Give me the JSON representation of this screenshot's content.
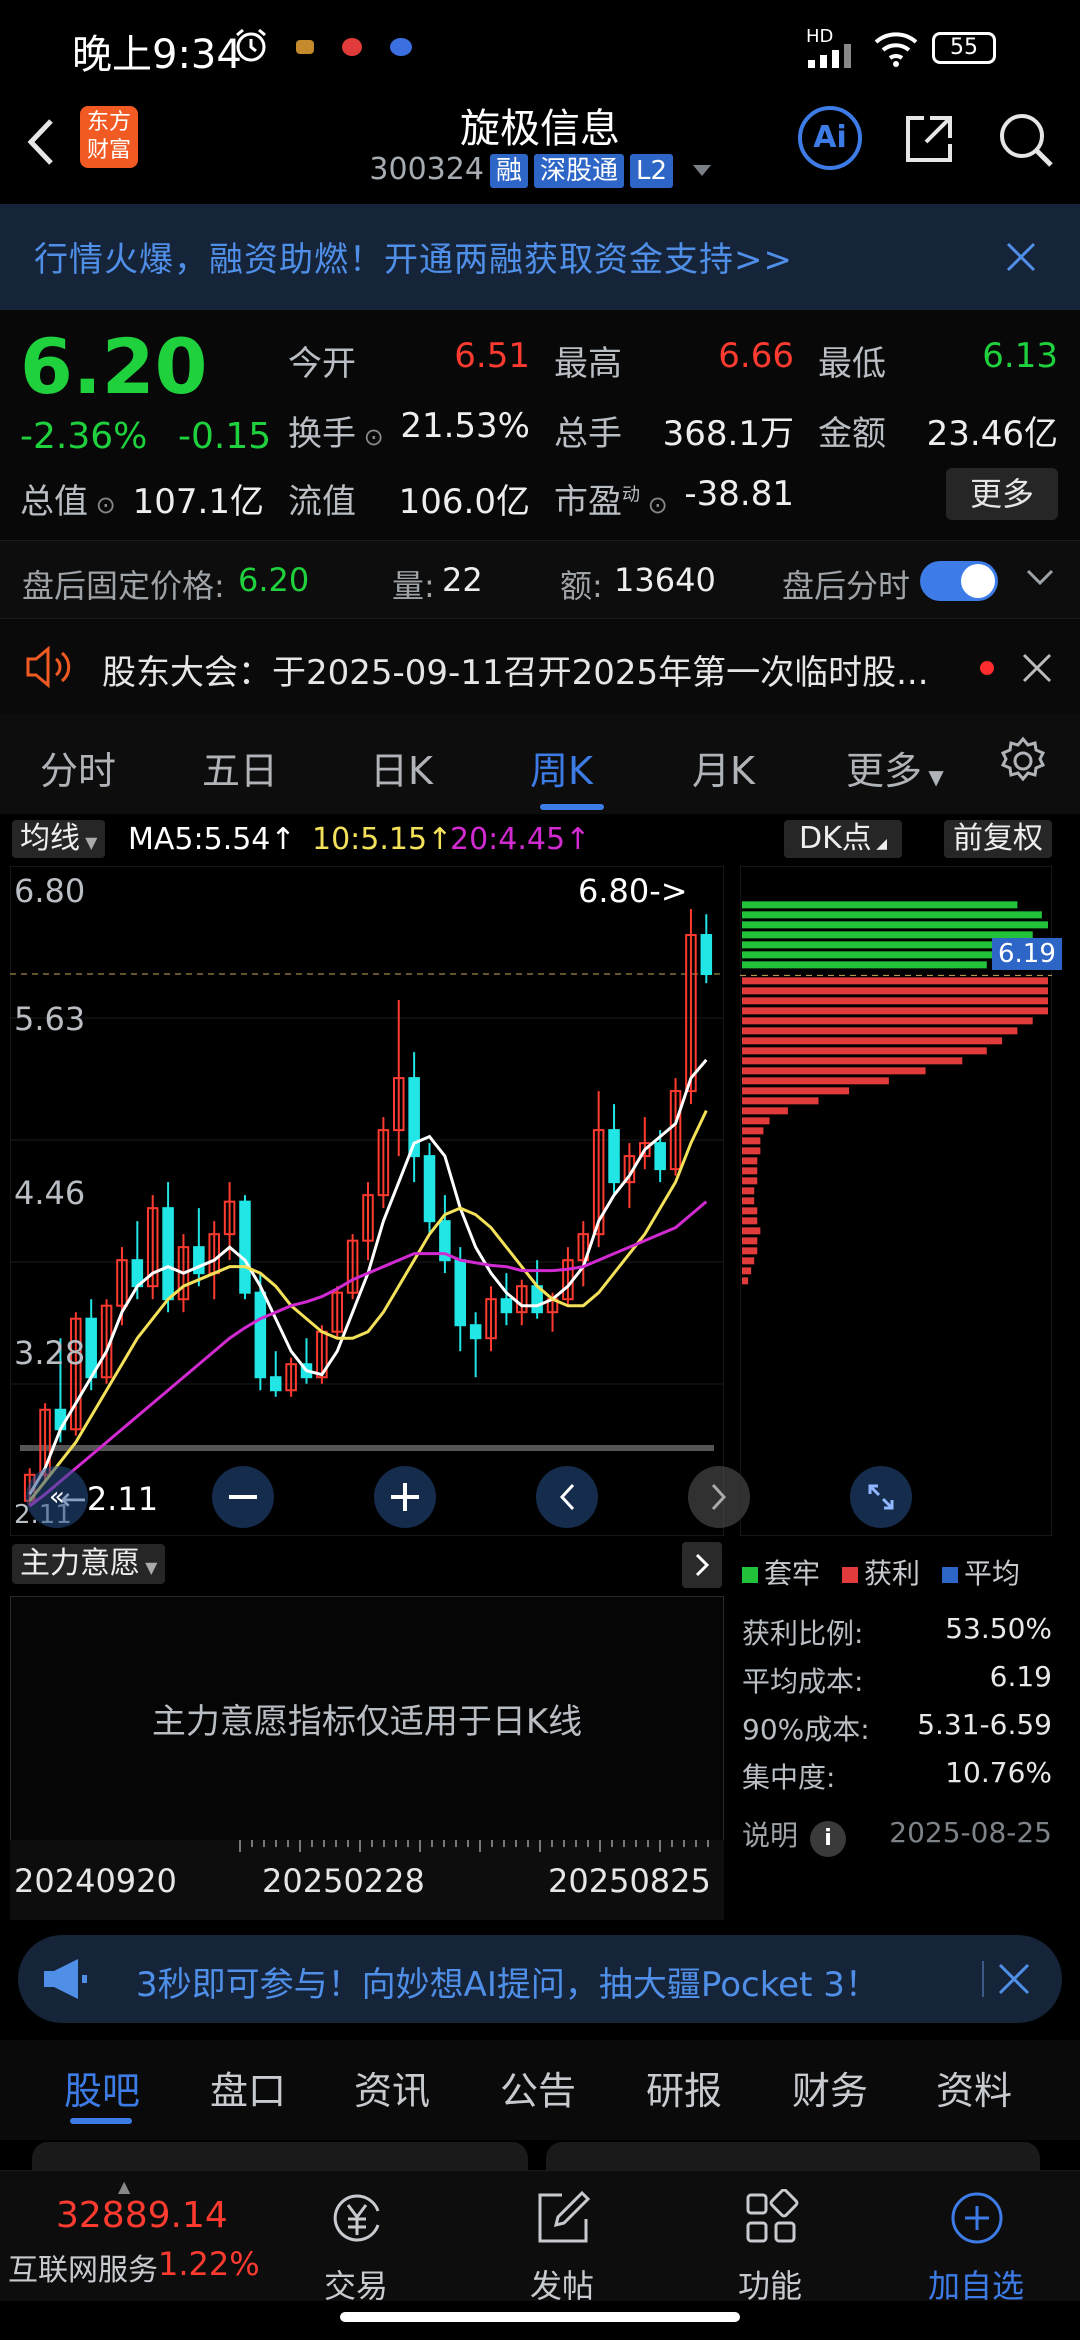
{
  "status_bar": {
    "time": "晚上9:34",
    "network": "HD",
    "battery": "55"
  },
  "header": {
    "logo_line1": "东方",
    "logo_line2": "财富",
    "title": "旋极信息",
    "code": "300324",
    "tags": [
      "融",
      "深股通",
      "L2"
    ],
    "ai_label": "Ai"
  },
  "banner": {
    "text": "行情火爆，融资助燃！开通两融获取资金支持>>"
  },
  "quote": {
    "price": "6.20",
    "change_pct": "-2.36%",
    "change": "-0.15",
    "open_label": "今开",
    "open": "6.51",
    "high_label": "最高",
    "high": "6.66",
    "low_label": "最低",
    "low": "6.13",
    "turnover_label": "换手",
    "turnover": "21.53%",
    "volume_label": "总手",
    "volume": "368.1万",
    "amount_label": "金额",
    "amount": "23.46亿",
    "mktcap_label": "总值",
    "mktcap": "107.1亿",
    "float_label": "流值",
    "float": "106.0亿",
    "pe_label": "市盈",
    "pe_sup": "动",
    "pe": "-38.81",
    "more_label": "更多"
  },
  "after_hours": {
    "price_label": "盘后固定价格:",
    "price": "6.20",
    "vol_label": "量:",
    "vol": "22",
    "amt_label": "额:",
    "amt": "13640",
    "toggle_label": "盘后分时"
  },
  "notice": {
    "text": "股东大会：于2025-09-11召开2025年第一次临时股..."
  },
  "chart_tabs": {
    "items": [
      "分时",
      "五日",
      "日K",
      "周K",
      "月K",
      "更多"
    ],
    "active": 3
  },
  "ma_bar": {
    "selector": "均线",
    "ma5": "MA5:5.54↑",
    "ma10": "10:5.15↑",
    "ma20": "20:4.45↑",
    "dk": "DK点",
    "adjust": "前复权"
  },
  "colors": {
    "up": "#ff3b30",
    "down": "#22e6e6",
    "ma5": "#ffffff",
    "ma10": "#f4e15a",
    "ma20": "#d12ad1",
    "accent": "#3d7ce6"
  },
  "chart_data": {
    "type": "candlestick",
    "y_axis_labels": [
      "6.80",
      "5.63",
      "4.46",
      "3.28",
      "2.11"
    ],
    "ylim": [
      2.11,
      6.8
    ],
    "max_marker": "6.80->",
    "min_marker": "←2.11",
    "x_axis_labels": [
      "20240920",
      "20250228",
      "20250825"
    ],
    "ohlc": [
      [
        2.15,
        2.4,
        2.11,
        2.35
      ],
      [
        2.35,
        2.9,
        2.3,
        2.85
      ],
      [
        2.85,
        3.4,
        2.6,
        2.7
      ],
      [
        2.7,
        3.6,
        2.65,
        3.55
      ],
      [
        3.55,
        3.7,
        3.0,
        3.1
      ],
      [
        3.1,
        3.7,
        3.05,
        3.65
      ],
      [
        3.65,
        4.1,
        3.5,
        4.0
      ],
      [
        4.0,
        4.3,
        3.7,
        3.8
      ],
      [
        3.8,
        4.5,
        3.7,
        4.4
      ],
      [
        4.4,
        4.6,
        3.6,
        3.7
      ],
      [
        3.7,
        4.2,
        3.6,
        4.1
      ],
      [
        4.1,
        4.4,
        3.8,
        3.9
      ],
      [
        3.9,
        4.3,
        3.7,
        4.2
      ],
      [
        4.2,
        4.6,
        4.0,
        4.45
      ],
      [
        4.45,
        4.5,
        3.7,
        3.75
      ],
      [
        3.75,
        3.9,
        3.0,
        3.1
      ],
      [
        3.1,
        3.3,
        2.95,
        3.0
      ],
      [
        3.0,
        3.25,
        2.95,
        3.2
      ],
      [
        3.2,
        3.4,
        3.05,
        3.1
      ],
      [
        3.1,
        3.5,
        3.05,
        3.45
      ],
      [
        3.45,
        3.8,
        3.4,
        3.75
      ],
      [
        3.75,
        4.2,
        3.7,
        4.15
      ],
      [
        4.15,
        4.6,
        4.0,
        4.5
      ],
      [
        4.5,
        5.1,
        4.4,
        5.0
      ],
      [
        5.0,
        6.0,
        4.8,
        5.4
      ],
      [
        5.4,
        5.6,
        4.6,
        4.8
      ],
      [
        4.8,
        4.9,
        4.2,
        4.3
      ],
      [
        4.3,
        4.5,
        3.9,
        4.0
      ],
      [
        4.0,
        4.1,
        3.3,
        3.5
      ],
      [
        3.5,
        3.6,
        3.1,
        3.4
      ],
      [
        3.4,
        3.8,
        3.3,
        3.7
      ],
      [
        3.7,
        3.9,
        3.5,
        3.6
      ],
      [
        3.6,
        3.85,
        3.5,
        3.8
      ],
      [
        3.8,
        4.0,
        3.55,
        3.6
      ],
      [
        3.6,
        3.75,
        3.45,
        3.7
      ],
      [
        3.7,
        4.1,
        3.65,
        4.0
      ],
      [
        4.0,
        4.3,
        3.8,
        4.2
      ],
      [
        4.2,
        5.3,
        4.1,
        5.0
      ],
      [
        5.0,
        5.2,
        4.5,
        4.6
      ],
      [
        4.6,
        4.9,
        4.4,
        4.8
      ],
      [
        4.8,
        5.1,
        4.7,
        4.9
      ],
      [
        4.9,
        5.0,
        4.6,
        4.7
      ],
      [
        4.7,
        5.4,
        4.65,
        5.3
      ],
      [
        5.3,
        6.7,
        5.2,
        6.5
      ],
      [
        6.5,
        6.66,
        6.13,
        6.2
      ]
    ],
    "ma5": [
      2.2,
      2.4,
      2.7,
      2.9,
      3.1,
      3.3,
      3.6,
      3.8,
      3.9,
      3.95,
      3.9,
      3.95,
      4.0,
      4.1,
      4.0,
      3.8,
      3.55,
      3.3,
      3.15,
      3.12,
      3.3,
      3.6,
      3.9,
      4.3,
      4.6,
      4.9,
      4.95,
      4.8,
      4.4,
      4.1,
      3.9,
      3.75,
      3.65,
      3.65,
      3.7,
      3.8,
      3.95,
      4.3,
      4.5,
      4.65,
      4.85,
      4.95,
      5.05,
      5.4,
      5.54
    ],
    "ma10": [
      2.15,
      2.3,
      2.45,
      2.6,
      2.8,
      3.0,
      3.2,
      3.4,
      3.55,
      3.7,
      3.8,
      3.85,
      3.9,
      3.95,
      3.95,
      3.9,
      3.8,
      3.65,
      3.55,
      3.45,
      3.4,
      3.4,
      3.45,
      3.6,
      3.8,
      4.0,
      4.2,
      4.35,
      4.4,
      4.35,
      4.25,
      4.1,
      3.95,
      3.8,
      3.7,
      3.65,
      3.65,
      3.75,
      3.9,
      4.05,
      4.2,
      4.4,
      4.6,
      4.9,
      5.15
    ],
    "ma20": [
      2.11,
      2.2,
      2.3,
      2.4,
      2.5,
      2.6,
      2.7,
      2.8,
      2.9,
      3.0,
      3.1,
      3.2,
      3.3,
      3.4,
      3.48,
      3.55,
      3.6,
      3.65,
      3.68,
      3.72,
      3.78,
      3.85,
      3.9,
      3.95,
      4.0,
      4.05,
      4.05,
      4.05,
      4.0,
      3.98,
      3.96,
      3.95,
      3.92,
      3.92,
      3.92,
      3.93,
      3.95,
      4.0,
      4.05,
      4.1,
      4.15,
      4.2,
      4.25,
      4.35,
      4.45
    ],
    "profile_price": "6.19",
    "profile_red": [
      1,
      1,
      1,
      1,
      0.95,
      0.9,
      0.85,
      0.8,
      0.72,
      0.6,
      0.48,
      0.35,
      0.25,
      0.15,
      0.09,
      0.07,
      0.06,
      0.06,
      0.05,
      0.05,
      0.05,
      0.04,
      0.04,
      0.05,
      0.05,
      0.06,
      0.05,
      0.05,
      0.04,
      0.03,
      0.02
    ],
    "profile_green": [
      0.8,
      0.85,
      0.9,
      0.95,
      1,
      0.98,
      0.9
    ]
  },
  "chip_legend": {
    "trapped": "套牢",
    "profit": "获利",
    "avg": "平均"
  },
  "lower_indicator": {
    "selector": "主力意愿",
    "message": "主力意愿指标仅适用于日K线"
  },
  "stats": {
    "profit_ratio_label": "获利比例:",
    "profit_ratio": "53.50%",
    "avg_cost_label": "平均成本:",
    "avg_cost": "6.19",
    "cost90_label": "90%成本:",
    "cost90": "5.31-6.59",
    "concentration_label": "集中度:",
    "concentration": "10.76%",
    "info_label": "说明",
    "date": "2025-08-25"
  },
  "ad": {
    "text": "3秒即可参与！向妙想AI提问，抽大疆Pocket 3！"
  },
  "content_tabs": {
    "items": [
      "股吧",
      "盘口",
      "资讯",
      "公告",
      "研报",
      "财务",
      "资料"
    ],
    "active": 0
  },
  "bottom_nav": {
    "index_value": "32889.14",
    "index_name": "互联网服务",
    "index_change": "1.22%",
    "items": [
      "交易",
      "发帖",
      "功能",
      "加自选"
    ]
  }
}
